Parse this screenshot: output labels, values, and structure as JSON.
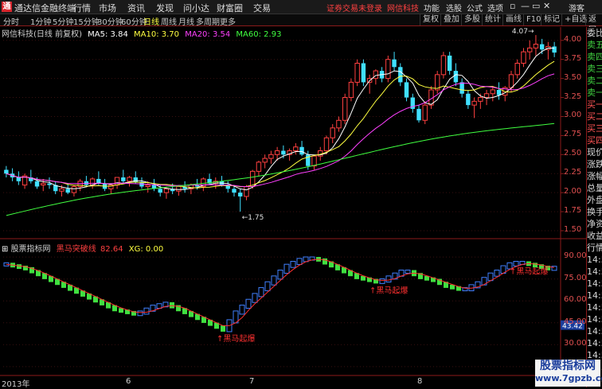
{
  "app": {
    "title": "通达信金融终端",
    "notice": "证券交易未登录",
    "broker": "网信科技",
    "user": "游客"
  },
  "menu": [
    "行情",
    "市场",
    "资讯",
    "发现",
    "问小达",
    "财富圈",
    "交易"
  ],
  "right_menu": [
    "功能",
    "选股",
    "公式",
    "选项"
  ],
  "window_buttons": [
    "▫",
    "—",
    "▭",
    "✕"
  ],
  "periods": [
    "分时",
    "1分钟",
    "5分钟",
    "15分钟",
    "30分钟",
    "60分钟",
    "日线",
    "周线",
    "月线",
    "多周期",
    "更多"
  ],
  "active_period": "日线",
  "toolbar_right": [
    "复权",
    "叠加",
    "多股",
    "统计",
    "画线",
    "F10",
    "标记",
    "+自选",
    "返回"
  ],
  "stock_label": "网信科技(日线 前复权)",
  "ma": {
    "ma5": "MA5: 3.84",
    "ma10": "MA10: 3.70",
    "ma20": "MA20: 3.54",
    "ma60": "MA60: 2.93"
  },
  "price_axis": [
    "4.00",
    "3.75",
    "3.50",
    "3.25",
    "3.00",
    "2.75",
    "2.50",
    "2.25",
    "2.00",
    "1.75",
    "1.50"
  ],
  "annotations": {
    "high": "4.07",
    "low": "1.75",
    "low_arrow": "←1.75",
    "high_arrow": "4.07→"
  },
  "indicator": {
    "source": "股票指标网",
    "name": "黑马突破线",
    "value": "82.64",
    "xg": "XG: 0.00",
    "axis": [
      "90.00",
      "75.00",
      "60.00",
      "45.00",
      "30.00",
      "15.00"
    ],
    "current": "43.42",
    "signal_label": "黑马起爆",
    "signal_arrow": "↑"
  },
  "time_axis": [
    "2013年",
    "6",
    "7",
    "8"
  ],
  "right_panel": [
    "委比",
    "卖五",
    "卖四",
    "卖三",
    "卖二",
    "卖一",
    "买一",
    "买二",
    "买三",
    "买四",
    "现价",
    "涨跌",
    "涨幅",
    "总量",
    "外盘",
    "换手",
    "净资",
    "收益",
    "行情",
    "14:5",
    "14:5",
    "14:5",
    "14:5",
    "14:5",
    "14:5",
    "14:5",
    "14:5",
    "14:5",
    "14:5",
    "14:5"
  ],
  "watermark": {
    "line1": "股票指标网",
    "line2": "www.7gpzb.com"
  },
  "colors": {
    "up": "#ff4040",
    "down": "#40e0ff",
    "ma5": "#ffffff",
    "ma10": "#ffff40",
    "ma20": "#ff40ff",
    "ma60": "#40ff40",
    "ind_up": "#4080ff",
    "ind_down": "#40e040"
  },
  "chart_data": {
    "type": "candlestick",
    "title": "网信科技(日线 前复权)",
    "ylim": [
      1.5,
      4.05
    ],
    "candles": [
      [
        2.3,
        2.35,
        2.2,
        2.25
      ],
      [
        2.25,
        2.32,
        2.15,
        2.2
      ],
      [
        2.2,
        2.28,
        2.1,
        2.15
      ],
      [
        2.1,
        2.25,
        2.05,
        2.22
      ],
      [
        2.2,
        2.3,
        2.12,
        2.15
      ],
      [
        2.15,
        2.2,
        2.05,
        2.08
      ],
      [
        2.1,
        2.18,
        2.02,
        2.12
      ],
      [
        2.12,
        2.2,
        2.05,
        2.1
      ],
      [
        2.1,
        2.15,
        1.98,
        2.02
      ],
      [
        2.02,
        2.1,
        1.95,
        2.05
      ],
      [
        2.05,
        2.12,
        1.98,
        2.0
      ],
      [
        2.0,
        2.1,
        1.95,
        2.08
      ],
      [
        2.08,
        2.18,
        2.02,
        2.15
      ],
      [
        2.15,
        2.22,
        2.08,
        2.1
      ],
      [
        2.1,
        2.2,
        2.05,
        2.18
      ],
      [
        2.18,
        2.28,
        2.1,
        2.12
      ],
      [
        2.12,
        2.18,
        2.02,
        2.05
      ],
      [
        2.05,
        2.12,
        1.98,
        2.1
      ],
      [
        2.1,
        2.2,
        2.05,
        2.2
      ],
      [
        2.2,
        2.3,
        2.12,
        2.15
      ],
      [
        2.15,
        2.22,
        2.08,
        2.2
      ],
      [
        2.2,
        2.28,
        2.12,
        2.14
      ],
      [
        2.14,
        2.2,
        2.05,
        2.08
      ],
      [
        2.08,
        2.15,
        2.0,
        2.1
      ],
      [
        2.1,
        2.18,
        2.02,
        2.05
      ],
      [
        2.05,
        2.1,
        1.95,
        2.0
      ],
      [
        2.0,
        2.08,
        1.92,
        2.05
      ],
      [
        2.05,
        2.12,
        1.98,
        2.02
      ],
      [
        2.02,
        2.1,
        1.96,
        2.08
      ],
      [
        2.08,
        2.15,
        2.0,
        2.05
      ],
      [
        2.05,
        2.12,
        1.98,
        2.1
      ],
      [
        2.1,
        2.18,
        2.04,
        2.08
      ],
      [
        2.08,
        2.2,
        2.02,
        2.18
      ],
      [
        2.18,
        2.25,
        2.1,
        2.12
      ],
      [
        2.12,
        2.2,
        2.05,
        2.15
      ],
      [
        2.15,
        2.22,
        2.08,
        2.1
      ],
      [
        2.1,
        2.15,
        2.0,
        2.05
      ],
      [
        2.05,
        2.1,
        1.95,
        2.0
      ],
      [
        2.0,
        2.05,
        1.75,
        1.95
      ],
      [
        1.95,
        2.1,
        1.9,
        2.08
      ],
      [
        2.08,
        2.3,
        2.05,
        2.28
      ],
      [
        2.28,
        2.42,
        2.22,
        2.4
      ],
      [
        2.4,
        2.5,
        2.32,
        2.45
      ],
      [
        2.45,
        2.55,
        2.38,
        2.5
      ],
      [
        2.5,
        2.6,
        2.42,
        2.55
      ],
      [
        2.55,
        2.62,
        2.45,
        2.5
      ],
      [
        2.5,
        2.58,
        2.42,
        2.55
      ],
      [
        2.55,
        2.65,
        2.5,
        2.6
      ],
      [
        2.6,
        2.68,
        2.48,
        2.5
      ],
      [
        2.5,
        2.55,
        2.3,
        2.35
      ],
      [
        2.35,
        2.5,
        2.3,
        2.48
      ],
      [
        2.48,
        2.6,
        2.42,
        2.55
      ],
      [
        2.55,
        2.75,
        2.5,
        2.72
      ],
      [
        2.72,
        2.9,
        2.65,
        2.85
      ],
      [
        2.85,
        3.0,
        2.8,
        2.95
      ],
      [
        2.95,
        3.3,
        2.9,
        3.25
      ],
      [
        3.25,
        3.5,
        3.2,
        3.45
      ],
      [
        3.45,
        3.75,
        3.4,
        3.7
      ],
      [
        3.7,
        3.75,
        3.4,
        3.45
      ],
      [
        3.45,
        3.55,
        3.3,
        3.5
      ],
      [
        3.5,
        3.62,
        3.42,
        3.6
      ],
      [
        3.6,
        3.65,
        3.45,
        3.5
      ],
      [
        3.5,
        3.8,
        3.45,
        3.75
      ],
      [
        3.75,
        3.85,
        3.6,
        3.65
      ],
      [
        3.65,
        3.7,
        3.4,
        3.45
      ],
      [
        3.45,
        3.5,
        3.2,
        3.25
      ],
      [
        3.25,
        3.3,
        3.05,
        3.1
      ],
      [
        3.1,
        3.15,
        2.92,
        2.95
      ],
      [
        2.95,
        3.2,
        2.9,
        3.15
      ],
      [
        3.15,
        3.4,
        3.1,
        3.35
      ],
      [
        3.35,
        3.6,
        3.3,
        3.55
      ],
      [
        3.55,
        3.85,
        3.5,
        3.8
      ],
      [
        3.8,
        3.85,
        3.55,
        3.6
      ],
      [
        3.6,
        3.7,
        3.4,
        3.45
      ],
      [
        3.45,
        3.5,
        3.25,
        3.3
      ],
      [
        3.3,
        3.35,
        3.1,
        3.15
      ],
      [
        3.15,
        3.25,
        2.98,
        3.2
      ],
      [
        3.2,
        3.3,
        3.1,
        3.25
      ],
      [
        3.25,
        3.35,
        3.15,
        3.3
      ],
      [
        3.3,
        3.4,
        3.2,
        3.35
      ],
      [
        3.35,
        3.45,
        3.22,
        3.28
      ],
      [
        3.28,
        3.4,
        3.2,
        3.38
      ],
      [
        3.38,
        3.6,
        3.32,
        3.55
      ],
      [
        3.55,
        3.75,
        3.5,
        3.7
      ],
      [
        3.7,
        3.9,
        3.65,
        3.85
      ],
      [
        3.85,
        4.0,
        3.75,
        3.9
      ],
      [
        3.9,
        4.07,
        3.8,
        3.95
      ],
      [
        3.95,
        4.02,
        3.82,
        3.88
      ],
      [
        3.88,
        3.98,
        3.75,
        3.92
      ],
      [
        3.92,
        3.98,
        3.78,
        3.84
      ]
    ],
    "indicator_values": [
      85,
      84,
      83,
      82,
      80,
      78,
      76,
      74,
      72,
      70,
      68,
      66,
      64,
      62,
      60,
      58,
      56,
      54,
      53,
      52,
      51,
      52,
      54,
      56,
      57,
      58,
      56,
      54,
      52,
      50,
      48,
      46,
      44,
      42,
      40,
      46,
      52,
      56,
      60,
      64,
      68,
      72,
      76,
      80,
      84,
      86,
      88,
      89,
      89,
      88,
      86,
      84,
      82,
      80,
      78,
      76,
      75,
      74,
      73,
      74,
      76,
      78,
      80,
      80,
      78,
      76,
      75,
      74,
      72,
      70,
      69,
      68,
      68,
      70,
      72,
      75,
      78,
      80,
      83,
      85,
      86,
      86,
      85,
      84,
      83,
      82,
      82.64
    ]
  }
}
